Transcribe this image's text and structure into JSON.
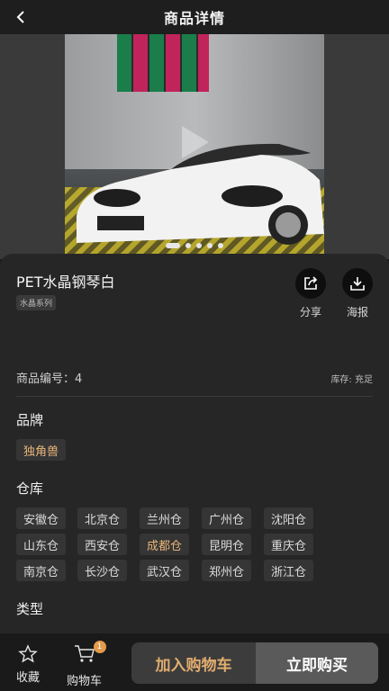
{
  "header": {
    "title": "商品详情",
    "back_icon": "chevron-left-icon"
  },
  "gallery": {
    "slides": 5,
    "active_slide": 1,
    "play_icon": "play-icon"
  },
  "product": {
    "name": "PET水晶钢琴白",
    "series_tag": "水晶系列",
    "code_label": "商品编号：4",
    "stock_label": "库存: 充足"
  },
  "actions": {
    "share": {
      "label": "分享",
      "icon": "share-icon"
    },
    "poster": {
      "label": "海报",
      "icon": "download-icon"
    }
  },
  "brand": {
    "title": "品牌",
    "options": [
      "独角兽"
    ],
    "selected": "独角兽"
  },
  "warehouse": {
    "title": "仓库",
    "options": [
      "安徽仓",
      "北京仓",
      "兰州仓",
      "广州仓",
      "沈阳仓",
      "山东仓",
      "西安仓",
      "成都仓",
      "昆明仓",
      "重庆仓",
      "南京仓",
      "长沙仓",
      "武汉仓",
      "郑州仓",
      "浙江仓"
    ],
    "selected": "成都仓"
  },
  "type": {
    "title": "类型"
  },
  "bottom": {
    "favorite_label": "收藏",
    "cart_label": "购物车",
    "cart_count": "1",
    "add_to_cart": "加入购物车",
    "buy_now": "立即购买"
  },
  "colors": {
    "accent": "#e8b57a",
    "sheet": "#262626",
    "badge": "#e29b4a"
  }
}
